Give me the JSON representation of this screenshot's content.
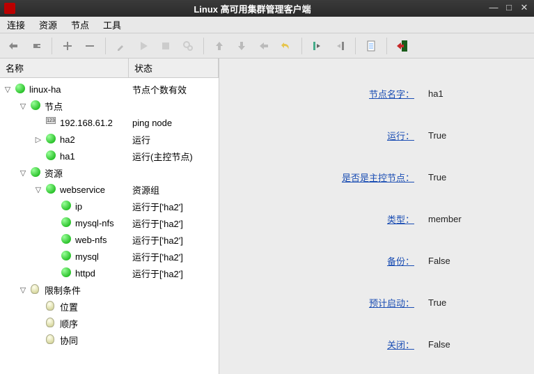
{
  "window": {
    "title": "Linux 高可用集群管理客户端"
  },
  "menubar": [
    "连接",
    "资源",
    "节点",
    "工具"
  ],
  "headers": {
    "col1": "名称",
    "col2": "状态"
  },
  "tree": [
    {
      "depth": 0,
      "toggle": "▽",
      "icon": "dot-green",
      "name": "linux-ha",
      "status": "节点个数有效"
    },
    {
      "depth": 1,
      "toggle": "▽",
      "icon": "dot-green",
      "name": "节点",
      "status": ""
    },
    {
      "depth": 2,
      "toggle": "",
      "icon": "ip",
      "name": "192.168.61.2",
      "status": "ping node"
    },
    {
      "depth": 2,
      "toggle": "▷",
      "icon": "dot-green",
      "name": "ha2",
      "status": "运行"
    },
    {
      "depth": 2,
      "toggle": "",
      "icon": "dot-green",
      "name": "ha1",
      "status": "运行(主控节点)"
    },
    {
      "depth": 1,
      "toggle": "▽",
      "icon": "dot-green",
      "name": "资源",
      "status": ""
    },
    {
      "depth": 2,
      "toggle": "▽",
      "icon": "dot-green",
      "name": "webservice",
      "status": "资源组"
    },
    {
      "depth": 3,
      "toggle": "",
      "icon": "dot-green",
      "name": "ip",
      "status": "运行于['ha2']"
    },
    {
      "depth": 3,
      "toggle": "",
      "icon": "dot-green",
      "name": "mysql-nfs",
      "status": "运行于['ha2']"
    },
    {
      "depth": 3,
      "toggle": "",
      "icon": "dot-green",
      "name": "web-nfs",
      "status": "运行于['ha2']"
    },
    {
      "depth": 3,
      "toggle": "",
      "icon": "dot-green",
      "name": "mysql",
      "status": "运行于['ha2']"
    },
    {
      "depth": 3,
      "toggle": "",
      "icon": "dot-green",
      "name": "httpd",
      "status": "运行于['ha2']"
    },
    {
      "depth": 1,
      "toggle": "▽",
      "icon": "bulb",
      "name": "限制条件",
      "status": ""
    },
    {
      "depth": 2,
      "toggle": "",
      "icon": "bulb",
      "name": "位置",
      "status": ""
    },
    {
      "depth": 2,
      "toggle": "",
      "icon": "bulb",
      "name": "顺序",
      "status": ""
    },
    {
      "depth": 2,
      "toggle": "",
      "icon": "bulb",
      "name": "协同",
      "status": ""
    }
  ],
  "props": [
    {
      "label": "节点名字：",
      "value": "ha1"
    },
    {
      "label": "运行：",
      "value": "True"
    },
    {
      "label": "是否是主控节点：",
      "value": "True"
    },
    {
      "label": "类型：",
      "value": "member"
    },
    {
      "label": "备份：",
      "value": "False"
    },
    {
      "label": "预计启动：",
      "value": "True"
    },
    {
      "label": "关闭：",
      "value": "False"
    }
  ],
  "toolbar_icons": [
    "connect",
    "plug",
    "add",
    "remove",
    "brush",
    "play",
    "stop",
    "gears",
    "up",
    "down",
    "left",
    "undo",
    "align-left",
    "align-right",
    "doc",
    "exit"
  ]
}
